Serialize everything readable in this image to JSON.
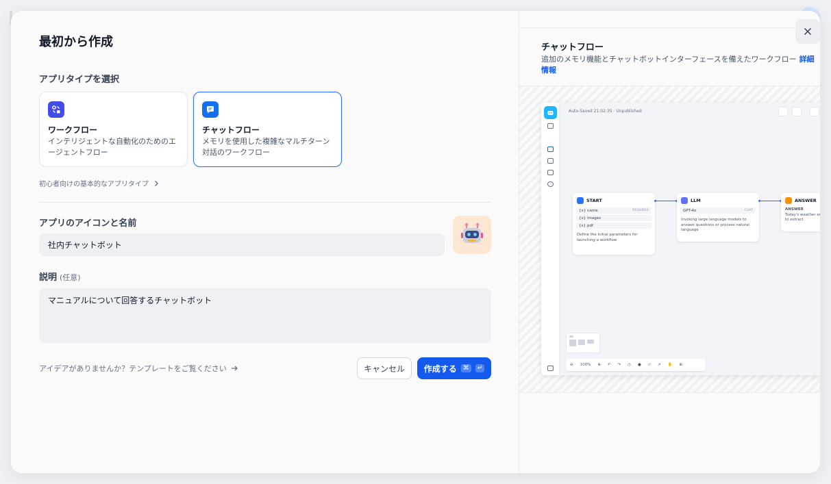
{
  "modal": {
    "title": "最初から作成",
    "app_type_label": "アプリタイプを選択",
    "types": [
      {
        "title": "ワークフロー",
        "desc": "インテリジェントな自動化のためのエージェントフロー",
        "icon": "workflow-icon",
        "color": "#444ce7"
      },
      {
        "title": "チャットフロー",
        "desc": "メモリを使用した複雑なマルチターン対話のワークフロー",
        "icon": "chatflow-icon",
        "color": "#1570ef",
        "selected": true
      }
    ],
    "beginner_link": "初心者向けの基本的なアプリタイプ",
    "name_label": "アプリのアイコンと名前",
    "name_value": "社内チャットボット",
    "app_icon": "robot-icon",
    "desc_label": "説明",
    "desc_optional": "(任意)",
    "desc_value": "マニュアルについて回答するチャットボット",
    "template_link": "アイデアがありませんか？テンプレートをご覧ください",
    "cancel_label": "キャンセル",
    "create_label": "作成する",
    "create_kbd_1": "⌘",
    "create_kbd_2": "↵",
    "accent": "#155aef"
  },
  "preview": {
    "title": "チャットフロー",
    "desc": "追加のメモリ機能とチャットボットインターフェースを備えたワークフロー",
    "learn_more": "詳細情報",
    "mock": {
      "status": "Auto-Saved 21:02:35 · Unpublished",
      "start": {
        "title": "START",
        "vars": [
          {
            "name": "{x} name",
            "tag": "REQUIRED"
          },
          {
            "name": "{x} images",
            "tag": ""
          },
          {
            "name": "{x} pdf",
            "tag": ""
          }
        ],
        "text": "Define the initial parameters for launching a workflow"
      },
      "llm": {
        "title": "LLM",
        "model": "GPT-4o",
        "mode": "CHAT",
        "text": "Invoking large language models to answer questions or process natural language"
      },
      "answer": {
        "title": "ANSWER",
        "label": "ANSWER",
        "text": "Today's weather entities to extract"
      },
      "zoom": "100%"
    }
  }
}
